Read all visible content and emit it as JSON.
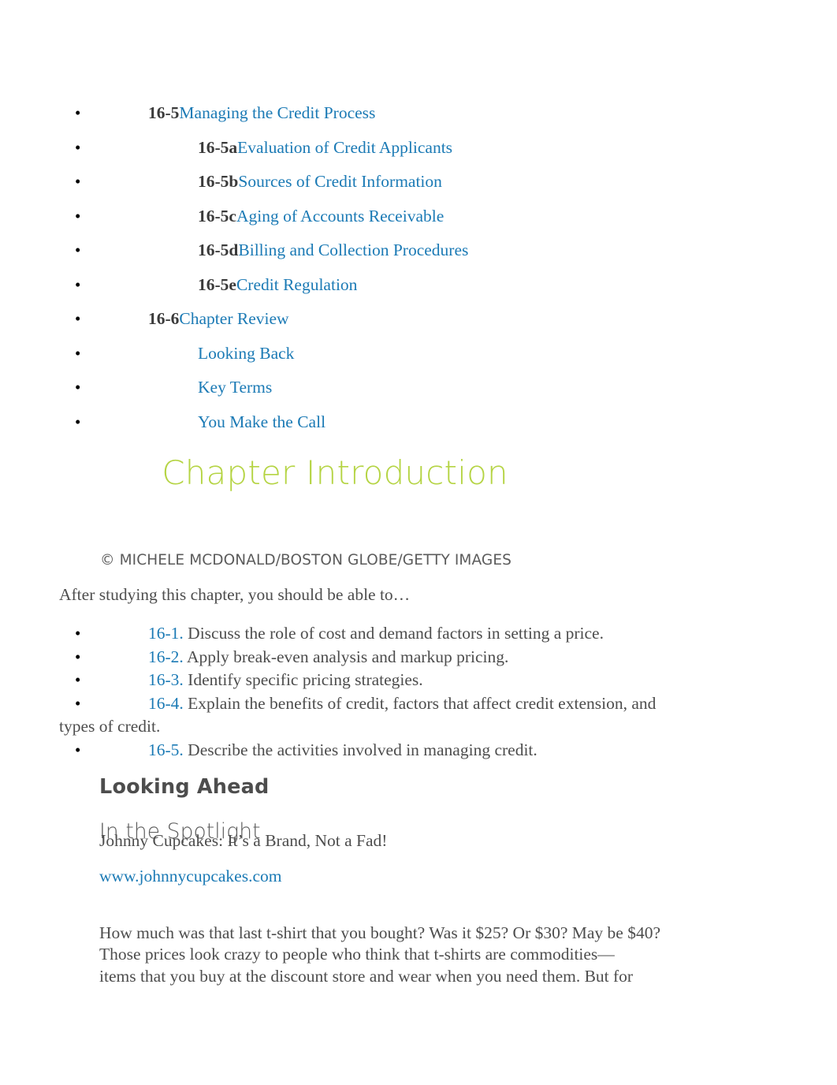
{
  "document": {
    "toc": {
      "items": [
        {
          "level": 1,
          "number": "16-5",
          "label": "Managing the Credit Process"
        },
        {
          "level": 2,
          "number": "16-5a",
          "label": "Evaluation of Credit Applicants"
        },
        {
          "level": 2,
          "number": "16-5b",
          "label": "Sources of Credit Information"
        },
        {
          "level": 2,
          "number": "16-5c",
          "label": "Aging of Accounts Receivable"
        },
        {
          "level": 2,
          "number": "16-5d",
          "label": "Billing and Collection Procedures"
        },
        {
          "level": 2,
          "number": "16-5e",
          "label": "Credit Regulation"
        },
        {
          "level": 1,
          "number": "16-6",
          "label": "Chapter Review"
        },
        {
          "level": 2,
          "number": "",
          "label": "Looking Back"
        },
        {
          "level": 2,
          "number": "",
          "label": "Key Terms"
        },
        {
          "level": 2,
          "number": "",
          "label": "You Make the Call"
        }
      ]
    },
    "heading": "Chapter Introduction",
    "photo_credit": "© MICHELE MCDONALD/BOSTON GLOBE/GETTY IMAGES",
    "objectives_intro": "After studying this chapter, you should be able to…",
    "objectives": [
      {
        "number": "16-1.",
        "text": " Discuss the role of cost and demand factors in setting a price."
      },
      {
        "number": "16-2.",
        "text": " Apply break-even analysis and markup pricing."
      },
      {
        "number": "16-3.",
        "text": " Identify specific pricing strategies."
      },
      {
        "number": "16-4.",
        "text": " Explain the benefits of credit, factors that affect credit extension, and",
        "continuation": "types of credit."
      },
      {
        "number": "16-5.",
        "text": " Describe the activities involved in managing credit."
      }
    ],
    "looking_ahead_heading": "Looking Ahead",
    "spotlight_heading": "In the Spotlight",
    "spotlight_subtitle": "Johnny Cupcakes: It’s a Brand, Not a Fad!",
    "spotlight_url": "www.johnnycupcakes.com",
    "body_paragraph": {
      "line1": "How much was that last t-shirt that you bought? Was it $25? Or $30? May be $40?",
      "line2": "Those prices look crazy to people who think that t-shirts are commodities—",
      "line3": "items that you buy at the discount store and wear when you need them. But for"
    },
    "colors": {
      "link_blue": "#1b7ab5",
      "heading_green": "#b5d444",
      "body_gray": "#4d4d4d",
      "number_dark": "#3a3a3a"
    }
  }
}
